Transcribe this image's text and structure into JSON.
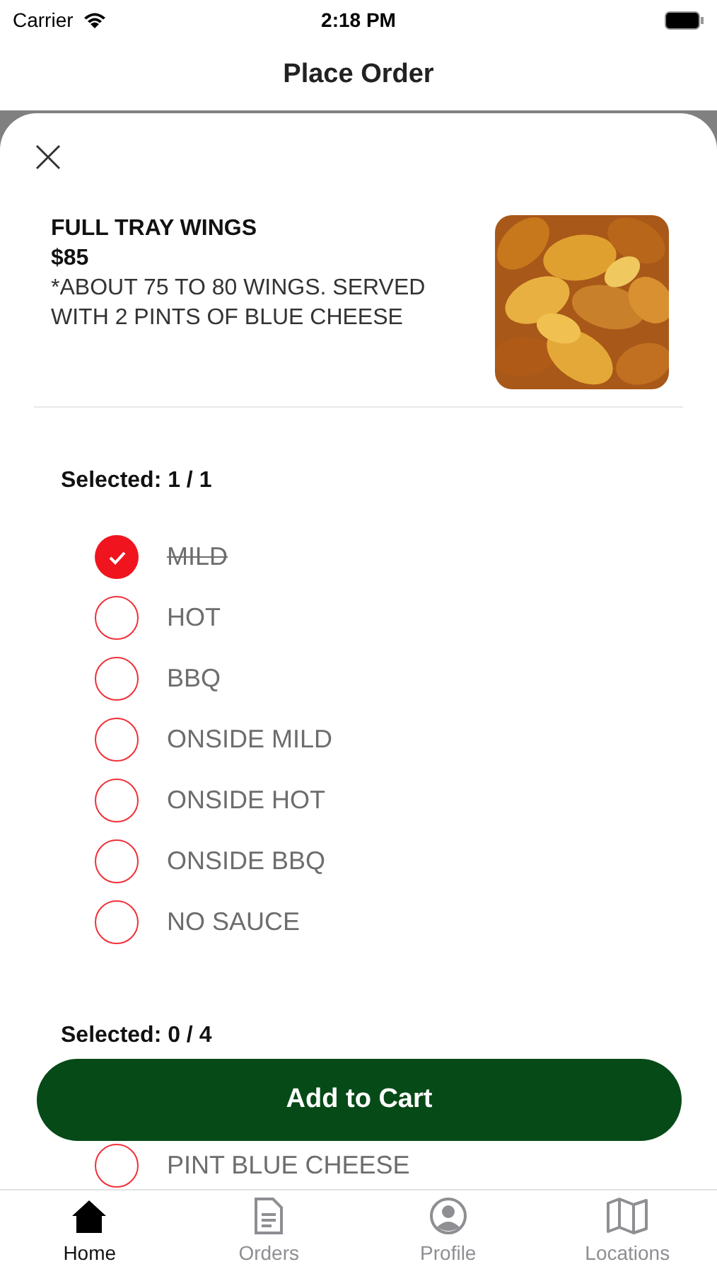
{
  "status_bar": {
    "carrier": "Carrier",
    "time": "2:18 PM"
  },
  "header": {
    "title": "Place Order"
  },
  "item": {
    "name": "FULL TRAY WINGS",
    "price": "$85",
    "description": "*ABOUT 75 TO 80 WINGS.  SERVED WITH 2 PINTS OF BLUE CHEESE"
  },
  "groups": [
    {
      "label": "Selected: 1 / 1",
      "options": [
        {
          "label": "MILD",
          "selected": true
        },
        {
          "label": "HOT",
          "selected": false
        },
        {
          "label": "BBQ",
          "selected": false
        },
        {
          "label": "ONSIDE MILD",
          "selected": false
        },
        {
          "label": "ONSIDE HOT",
          "selected": false
        },
        {
          "label": "ONSIDE BBQ",
          "selected": false
        },
        {
          "label": "NO SAUCE",
          "selected": false
        }
      ]
    },
    {
      "label": "Selected: 0 / 4",
      "options": [
        {
          "label": "PINT BLUE CHEESE",
          "selected": false
        }
      ]
    }
  ],
  "add_button": "Add to Cart",
  "tabs": [
    {
      "label": "Home",
      "kind": "home",
      "selected": true
    },
    {
      "label": "Orders",
      "kind": "orders",
      "selected": false
    },
    {
      "label": "Profile",
      "kind": "profile",
      "selected": false
    },
    {
      "label": "Locations",
      "kind": "locations",
      "selected": false
    }
  ]
}
